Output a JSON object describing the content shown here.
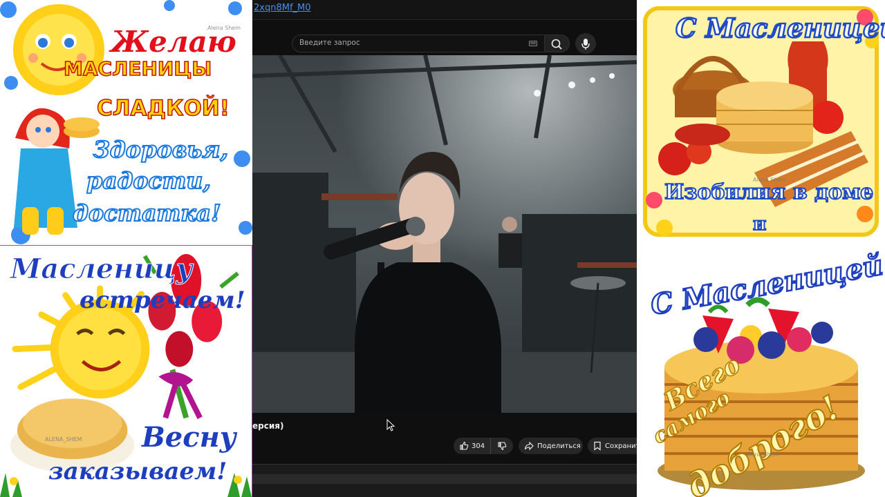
{
  "browser": {
    "url_fragment": "2xqn8Mf_M0"
  },
  "youtube": {
    "search": {
      "placeholder": "Введите запрос"
    },
    "video": {
      "title_fragment": "ерсия)",
      "like_count": "304",
      "share_label": "Поделиться",
      "save_label": "Сохранить"
    }
  },
  "cards": {
    "top_left": {
      "line1": "Желаю",
      "line2": "МАСЛЕНИЦЫ",
      "line3": "СЛАДКОЙ!",
      "line4": "Здоровья,",
      "line5": "радости,",
      "line6": "достатка!",
      "watermark": "Alena Shem"
    },
    "bottom_left": {
      "line1": "Масленицу",
      "line2": "встречаем!",
      "line3": "Весну",
      "line4": "заказываем!",
      "watermark": "ALENA_SHEM"
    },
    "top_right": {
      "line1": "С Масленицей!",
      "line2": "Изобилия в доме",
      "line3": "и",
      "watermark": "Alena Shem"
    },
    "bottom_right": {
      "line1": "С Масленицей!",
      "line2": "Всего",
      "line3": "самого",
      "line4": "доброго!",
      "watermark": "Alena Shem"
    }
  },
  "colors": {
    "youtube_bg": "#0f0f0f",
    "link_blue": "#4a8ef5",
    "card_red": "#e3101c",
    "card_yellow": "#ffd400",
    "card_blue": "#1d3fbf"
  }
}
